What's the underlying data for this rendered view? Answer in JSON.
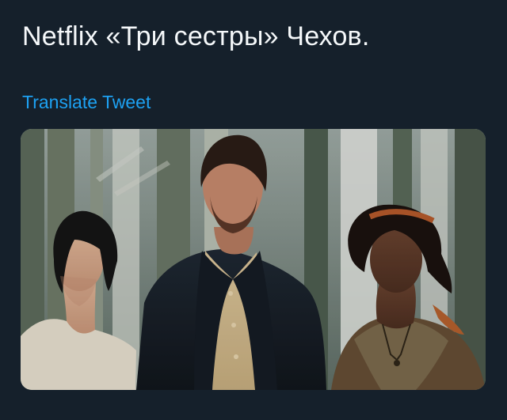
{
  "tweet": {
    "text": "Netflix «Три сестры» Чехов.",
    "translate_label": "Translate Tweet",
    "media": {
      "icon": "photo-icon"
    }
  },
  "colors": {
    "background": "#15202b",
    "text": "#f5f8fa",
    "link": "#1da1f2"
  }
}
